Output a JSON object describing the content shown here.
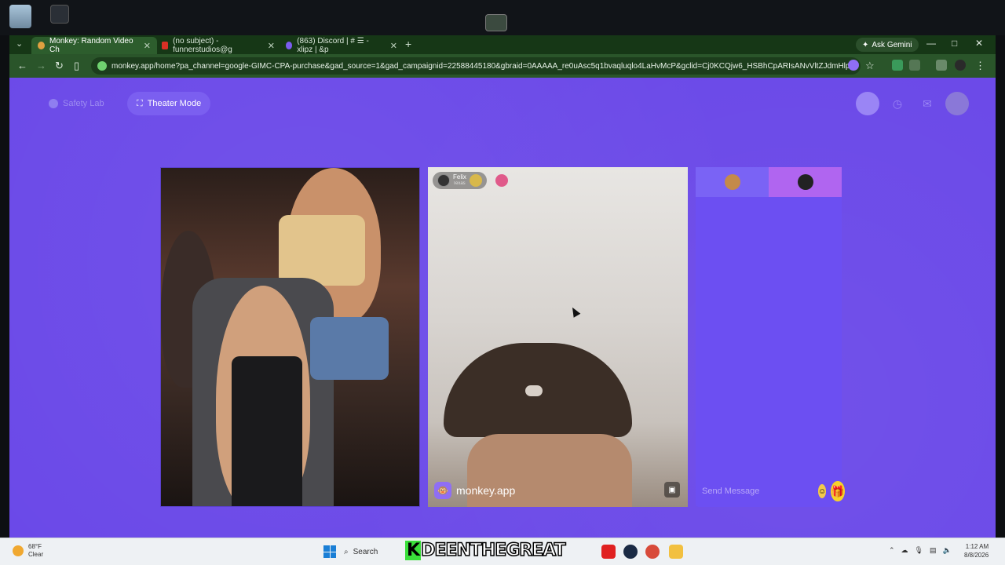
{
  "browser": {
    "tabs": [
      {
        "title": "Monkey: Random Video Ch",
        "active": true,
        "favicon_color": "#e0a040"
      },
      {
        "title": "(no subject) - funnerstudios@g",
        "active": false,
        "favicon_color": "#d93025"
      },
      {
        "title": "(863) Discord | # ☰ -xlipz | &p",
        "active": false,
        "favicon_color": "#7b5cf0"
      }
    ],
    "ask_gemini": "Ask Gemini",
    "url": "monkey.app/home?pa_channel=google-GIMC-CPA-purchase&gad_source=1&gad_campaignid=22588445180&gbraid=0AAAAA_re0uAsc5q1bvaqluqlo4LaHvMcP&gclid=Cj0KCQjw6_HSBhCpARIsANvVltZJdmHlp8bIKVMAOeG..."
  },
  "page": {
    "safety_lab_label": "Safety Lab",
    "theater_mode_label": "Theater Mode",
    "peer": {
      "name": "Felix",
      "sub": "Texas"
    },
    "watermark": "monkey.app",
    "chat_placeholder": "Send Message",
    "colors": {
      "background": "#6a48e8",
      "panel": "#6c4ff2",
      "accent": "#f7d22a"
    }
  },
  "taskbar": {
    "weather_temp": "68°F",
    "weather_desc": "Clear",
    "search_label": "Search",
    "streamer_name_k": "K",
    "streamer_name_rest": "DEENTHEGREAT",
    "time": "1:12 AM",
    "date": "8/8/2026"
  }
}
